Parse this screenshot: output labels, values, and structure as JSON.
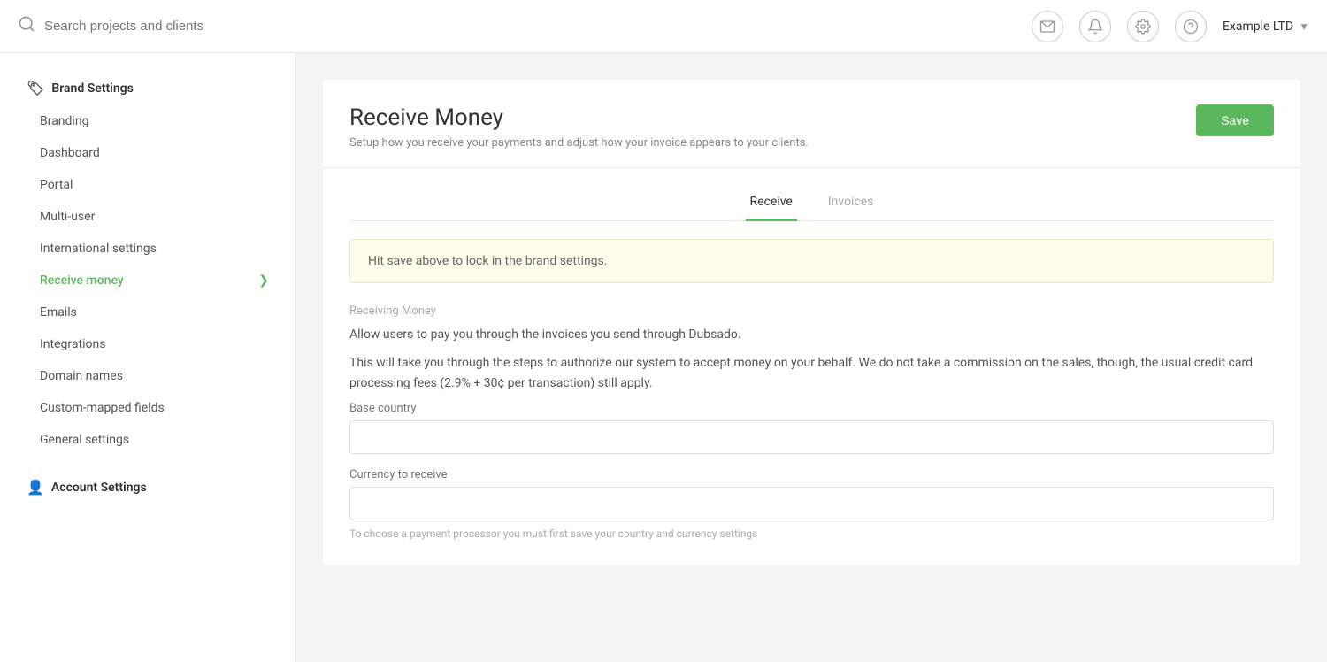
{
  "navbar": {
    "search_placeholder": "Search projects and clients",
    "company_name": "Example LTD"
  },
  "sidebar": {
    "brand_settings_label": "Brand Settings",
    "items_brand": [
      {
        "id": "branding",
        "label": "Branding",
        "active": false
      },
      {
        "id": "dashboard",
        "label": "Dashboard",
        "active": false
      },
      {
        "id": "portal",
        "label": "Portal",
        "active": false
      },
      {
        "id": "multi-user",
        "label": "Multi-user",
        "active": false
      },
      {
        "id": "international-settings",
        "label": "International settings",
        "active": false
      },
      {
        "id": "receive-money",
        "label": "Receive money",
        "active": true
      },
      {
        "id": "emails",
        "label": "Emails",
        "active": false
      },
      {
        "id": "integrations",
        "label": "Integrations",
        "active": false
      },
      {
        "id": "domain-names",
        "label": "Domain names",
        "active": false
      },
      {
        "id": "custom-mapped-fields",
        "label": "Custom-mapped fields",
        "active": false
      },
      {
        "id": "general-settings",
        "label": "General settings",
        "active": false
      }
    ],
    "account_settings_label": "Account Settings"
  },
  "main": {
    "page_title": "Receive Money",
    "page_subtitle": "Setup how you receive your payments and adjust how your invoice appears to your clients.",
    "save_label": "Save",
    "tabs": [
      {
        "id": "receive",
        "label": "Receive",
        "active": true
      },
      {
        "id": "invoices",
        "label": "Invoices",
        "active": false
      }
    ],
    "info_box_text": "Hit save above to lock in the brand settings.",
    "section_label": "Receiving Money",
    "section_desc1": "Allow users to pay you through the invoices you send through Dubsado.",
    "section_desc2": "This will take you through the steps to authorize our system to accept money on your behalf. We do not take a commission on the sales, though, the usual credit card processing fees (2.9% + 30¢ per transaction) still apply.",
    "base_country_label": "Base country",
    "base_country_placeholder": "",
    "currency_label": "Currency to receive",
    "currency_placeholder": "",
    "helper_text": "To choose a payment processor you must first save your country and currency settings"
  }
}
